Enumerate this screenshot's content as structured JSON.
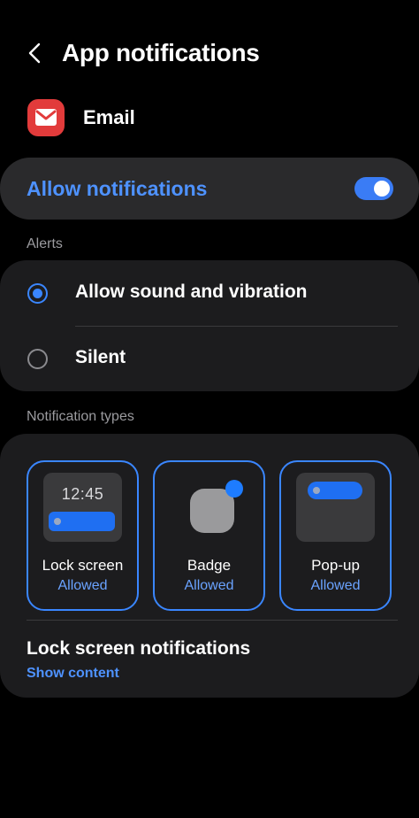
{
  "header": {
    "title": "App notifications"
  },
  "app": {
    "name": "Email"
  },
  "allow_notifications": {
    "label": "Allow notifications",
    "enabled": true
  },
  "alerts": {
    "section_label": "Alerts",
    "options": [
      {
        "label": "Allow sound and vibration",
        "selected": true
      },
      {
        "label": "Silent",
        "selected": false
      }
    ]
  },
  "notification_types": {
    "section_label": "Notification types",
    "tiles": [
      {
        "name": "Lock screen",
        "status": "Allowed",
        "preview_time": "12:45"
      },
      {
        "name": "Badge",
        "status": "Allowed"
      },
      {
        "name": "Pop-up",
        "status": "Allowed"
      }
    ]
  },
  "lock_screen_notifications": {
    "title": "Lock screen notifications",
    "value": "Show content"
  },
  "colors": {
    "accent": "#3a86ff",
    "accent_text": "#4e92ff",
    "card": "#1c1c1e",
    "app_icon": "#e23b3b"
  }
}
